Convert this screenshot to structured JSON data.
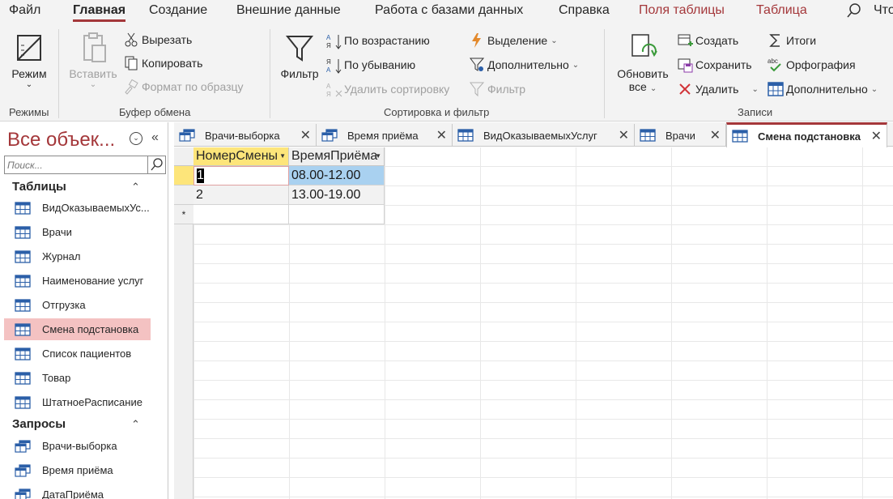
{
  "menu": {
    "items": [
      "Файл",
      "Главная",
      "Создание",
      "Внешние данные",
      "Работа с базами данных",
      "Справка",
      "Поля таблицы",
      "Таблица"
    ],
    "active": "Главная",
    "search_text": "Что"
  },
  "ribbon": {
    "views": {
      "view_label": "Режим",
      "group_label": "Режимы"
    },
    "clipboard": {
      "paste_label": "Вставить",
      "cut_label": "Вырезать",
      "copy_label": "Копировать",
      "format_painter_label": "Формат по образцу",
      "group_label": "Буфер обмена"
    },
    "sort_filter": {
      "filter_label": "Фильтр",
      "ascending_label": "По возрастанию",
      "descending_label": "По убыванию",
      "remove_sort_label": "Удалить сортировку",
      "selection_label": "Выделение",
      "advanced_label": "Дополнительно",
      "toggle_filter_label": "Фильтр",
      "group_label": "Сортировка и фильтр"
    },
    "records": {
      "refresh_label_1": "Обновить",
      "refresh_label_2": "все",
      "new_label": "Создать",
      "save_label": "Сохранить",
      "delete_label": "Удалить",
      "totals_label": "Итоги",
      "spelling_label": "Орфография",
      "more_label": "Дополнительно",
      "group_label": "Записи"
    }
  },
  "nav": {
    "title": "Все объек...",
    "search_placeholder": "Поиск...",
    "tables_section": "Таблицы",
    "tables": [
      "ВидОказываемыхУс...",
      "Врачи",
      "Журнал",
      "Наименование услуг",
      "Отгрузка",
      "Смена подстановка",
      "Список пациентов",
      "Товар",
      "ШтатноеРасписание"
    ],
    "selected_table": "Смена подстановка",
    "queries_section": "Запросы",
    "queries": [
      "Врачи-выборка",
      "Время приёма",
      "ДатаПриёма"
    ]
  },
  "tabs": [
    {
      "label": "Врачи-выборка",
      "kind": "query"
    },
    {
      "label": "Время приёма",
      "kind": "query"
    },
    {
      "label": "ВидОказываемыхУслуг",
      "kind": "table"
    },
    {
      "label": "Врачи",
      "kind": "table"
    },
    {
      "label": "Смена подстановка",
      "kind": "table",
      "active": true
    }
  ],
  "datasheet": {
    "columns": [
      "НомерСмены",
      "ВремяПриёма"
    ],
    "rows": [
      [
        "1",
        "08.00-12.00"
      ],
      [
        "2",
        "13.00-19.00"
      ]
    ],
    "new_row_marker": "*"
  },
  "colors": {
    "accent": "#a4373a",
    "selection": "#a9d1f0",
    "header_selected": "#fde57a",
    "nav_selected": "#f4c2c2"
  }
}
